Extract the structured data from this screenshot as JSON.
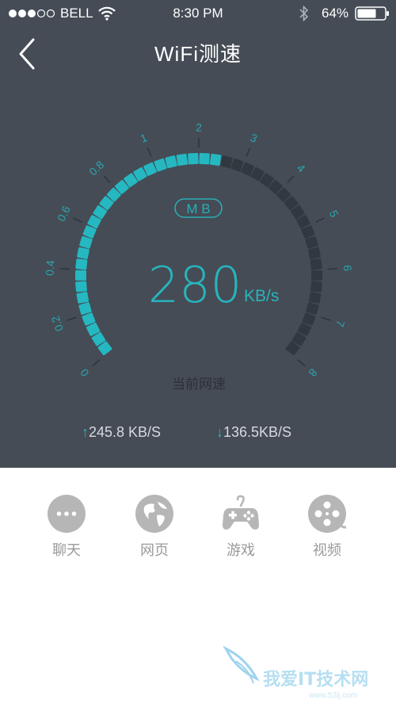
{
  "status_bar": {
    "carrier": "BELL",
    "time": "8:30 PM",
    "battery": "64%",
    "icons": [
      "signal-dots-icon",
      "wifi-icon",
      "bluetooth-icon",
      "battery-icon"
    ]
  },
  "header": {
    "title": "WiFi测速",
    "back_icon": "chevron-left-icon"
  },
  "gauge": {
    "unit_badge": "M B",
    "speed_value": "280",
    "speed_unit": "KB/s",
    "caption": "当前网速",
    "ticks": [
      "0",
      "0.2",
      "0.4",
      "0.6",
      "0.8",
      "1",
      "2",
      "3",
      "4",
      "5",
      "6",
      "7",
      "8"
    ],
    "fill_level_mb": 2.5,
    "scale_max_mb": 8,
    "active_color": "#25b8c1",
    "inactive_color": "#32383f"
  },
  "speeds": {
    "upload_arrow": "↑",
    "upload": "245.8 KB/S",
    "download_arrow": "↓",
    "download": "136.5KB/S"
  },
  "nav": {
    "items": [
      {
        "label": "聊天",
        "icon": "chat-bubble-icon"
      },
      {
        "label": "网页",
        "icon": "globe-icon"
      },
      {
        "label": "游戏",
        "icon": "gamepad-icon"
      },
      {
        "label": "视频",
        "icon": "film-reel-icon"
      }
    ]
  },
  "watermark": {
    "text": "我爱IT技术网",
    "subtext": "www.52ij.com"
  }
}
